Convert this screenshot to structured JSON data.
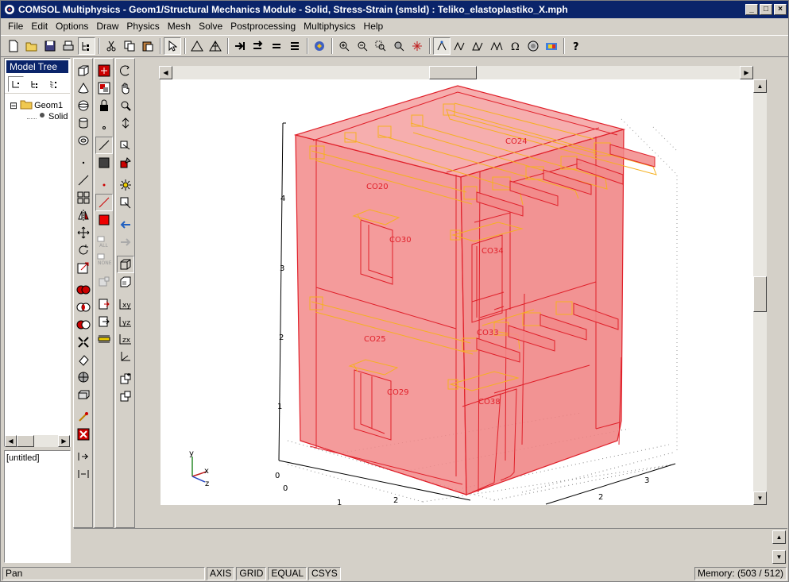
{
  "window": {
    "title": "COMSOL Multiphysics - Geom1/Structural Mechanics Module - Solid, Stress-Strain (smsld) : Teliko_elastoplastiko_X.mph",
    "minimize_icon": "minimize-icon",
    "maximize_icon": "maximize-icon",
    "close_icon": "close-icon"
  },
  "menu": {
    "items": [
      {
        "label": "File"
      },
      {
        "label": "Edit"
      },
      {
        "label": "Options"
      },
      {
        "label": "Draw"
      },
      {
        "label": "Physics"
      },
      {
        "label": "Mesh"
      },
      {
        "label": "Solve"
      },
      {
        "label": "Postprocessing"
      },
      {
        "label": "Multiphysics"
      },
      {
        "label": "Help"
      }
    ]
  },
  "model_tree": {
    "header": "Model Tree",
    "nodes": [
      {
        "label": "Geom1",
        "expander": "⊟"
      },
      {
        "label": "Solid"
      }
    ]
  },
  "untitled_box": {
    "text": "[untitled]"
  },
  "plot": {
    "labels": [
      "CO24",
      "CO20",
      "CO30",
      "CO34",
      "CO25",
      "CO33",
      "CO29",
      "CO38"
    ],
    "z_ticks": [
      "4",
      "3",
      "2",
      "1",
      "0"
    ],
    "x_ticks": [
      "0",
      "1",
      "2"
    ],
    "y_ticks": [
      "2",
      "3"
    ],
    "axis_x": "x",
    "axis_y": "y",
    "axis_z": "z",
    "fill_color": "#f28a8a",
    "edge_color": "#e0202a",
    "beam_color": "#f5b020"
  },
  "status": {
    "mode": "Pan",
    "axis": "AXIS",
    "grid": "GRID",
    "equal": "EQUAL",
    "csys": "CSYS",
    "memory": "Memory: (503 / 512)"
  }
}
